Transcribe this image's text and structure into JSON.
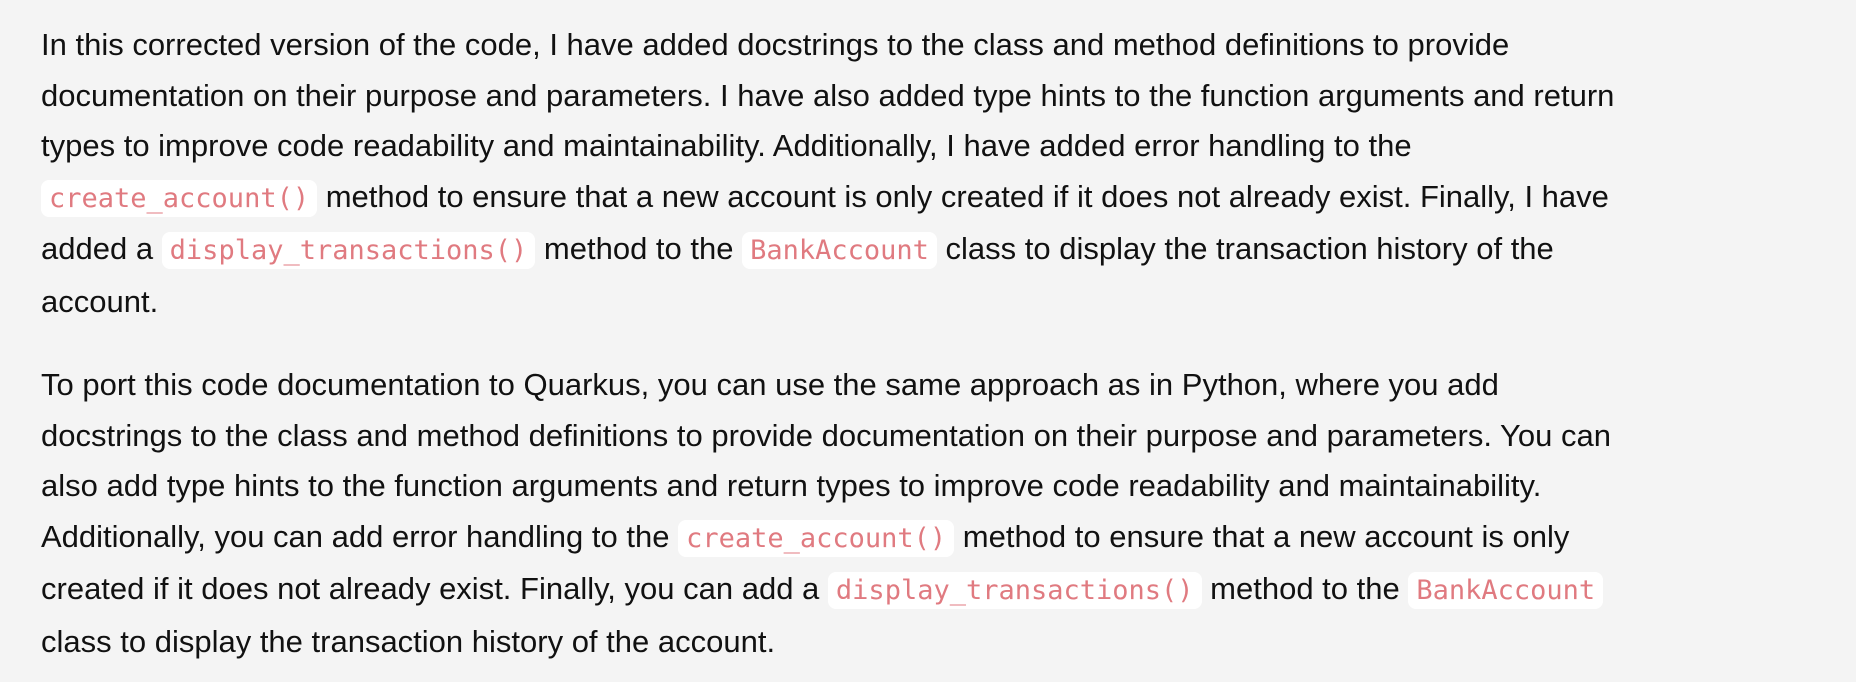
{
  "paragraphs": [
    {
      "lines": [
        [
          "In this corrected version of the code, I have added docstrings to the class and method definitions to provide"
        ],
        [
          "documentation on their purpose and parameters. I have also added type hints to the function arguments and return"
        ],
        [
          "types to improve code readability and maintainability. Additionally, I have added error handling to the"
        ],
        [
          {
            "code": "create_account()"
          },
          " method to ensure that a new account is only created if it does not already exist. Finally, I have"
        ],
        [
          "added a ",
          {
            "code": "display_transactions()"
          },
          " method to the ",
          {
            "code": "BankAccount"
          },
          " class to display the transaction history of the"
        ],
        [
          "account."
        ]
      ]
    },
    {
      "lines": [
        [
          "To port this code documentation to Quarkus, you can use the same approach as in Python, where you add"
        ],
        [
          "docstrings to the class and method definitions to provide documentation on their purpose and parameters. You can"
        ],
        [
          "also add type hints to the function arguments and return types to improve code readability and maintainability."
        ],
        [
          "Additionally, you can add error handling to the ",
          {
            "code": "create_account()"
          },
          " method to ensure that a new account is only"
        ],
        [
          "created if it does not already exist. Finally, you can add a ",
          {
            "code": "display_transactions()"
          },
          " method to the ",
          {
            "code": "BankAccount"
          }
        ],
        [
          "class to display the transaction history of the account."
        ]
      ]
    }
  ]
}
